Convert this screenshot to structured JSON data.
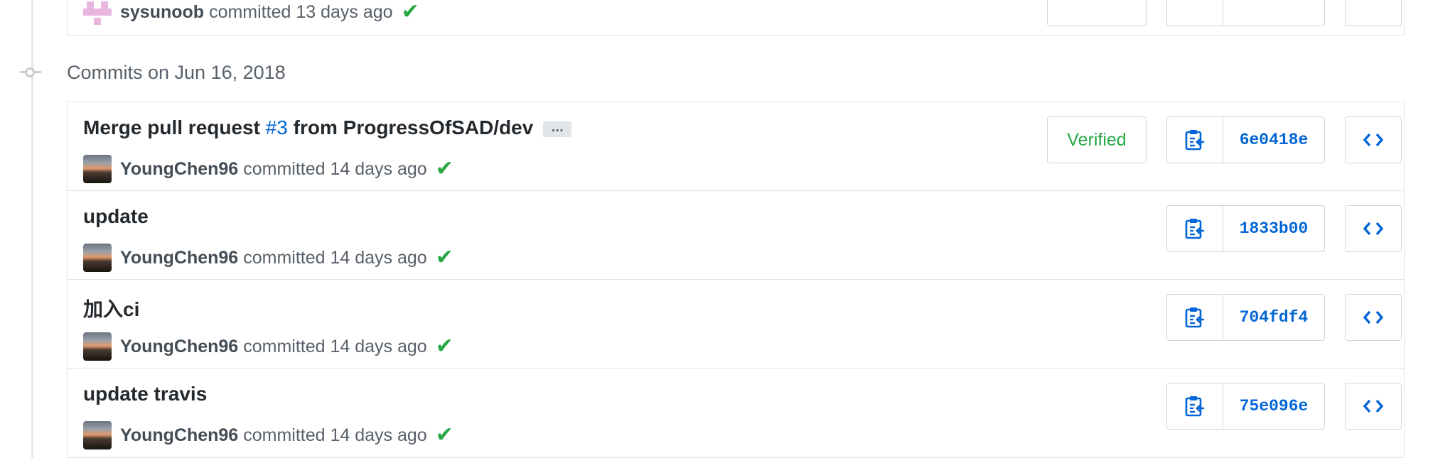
{
  "previous_commit": {
    "author": "sysunoob",
    "committed_text": "committed 13 days ago",
    "avatar_icon": "identicon-avatar",
    "status_icon": "check-icon"
  },
  "group": {
    "title": "Commits on Jun 16, 2018"
  },
  "commits": [
    {
      "message_prefix": "Merge pull request ",
      "pr_link": "#3",
      "message_suffix": " from ProgressOfSAD/dev",
      "ellipsis": "…",
      "author": "YoungChen96",
      "committed_text": "committed 14 days ago",
      "verified_label": "Verified",
      "sha": "6e0418e"
    },
    {
      "message": "update",
      "author": "YoungChen96",
      "committed_text": "committed 14 days ago",
      "sha": "1833b00"
    },
    {
      "message": "加入ci",
      "author": "YoungChen96",
      "committed_text": "committed 14 days ago",
      "sha": "704fdf4"
    },
    {
      "message": "update travis",
      "author": "YoungChen96",
      "committed_text": "committed 14 days ago",
      "sha": "75e096e"
    }
  ],
  "icons": {
    "copy": "clipboard-copy-icon",
    "browse": "code-brackets-icon",
    "check": "check-icon",
    "timeline_node": "git-commit-icon"
  },
  "colors": {
    "link": "#0366d6",
    "success": "#28a745",
    "border": "#e1e4e8",
    "muted_text": "#586069"
  }
}
